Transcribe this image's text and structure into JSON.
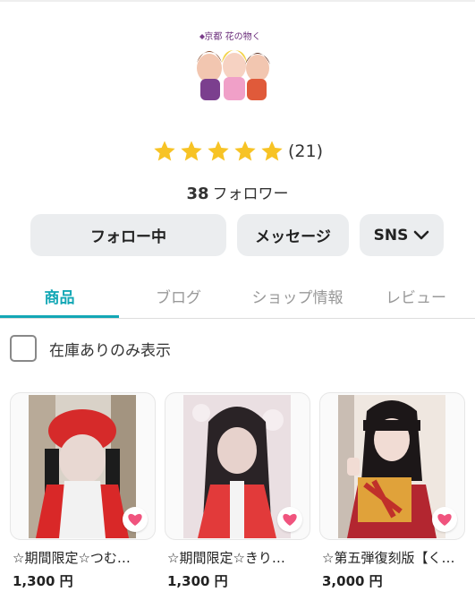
{
  "shop": {
    "logo_text": "京都 花の物く",
    "rating_stars": 5,
    "rating_count": "(21)",
    "followers_count": "38",
    "followers_label": "フォロワー"
  },
  "actions": {
    "follow_label": "フォロー中",
    "message_label": "メッセージ",
    "sns_label": "SNS"
  },
  "tabs": [
    {
      "label": "商品",
      "active": true
    },
    {
      "label": "ブログ",
      "active": false
    },
    {
      "label": "ショップ情報",
      "active": false
    },
    {
      "label": "レビュー",
      "active": false
    }
  ],
  "filter": {
    "in_stock_label": "在庫ありのみ表示",
    "checked": false
  },
  "products": [
    {
      "title": "☆期間限定☆つむ…",
      "price": "1,300 円"
    },
    {
      "title": "☆期間限定☆きり…",
      "price": "1,300 円"
    },
    {
      "title": "☆第五弾復刻版【く…",
      "price": "3,000 円"
    }
  ],
  "colors": {
    "accent": "#13a7b5",
    "star": "#f7c325",
    "heart": "#f0547e"
  }
}
